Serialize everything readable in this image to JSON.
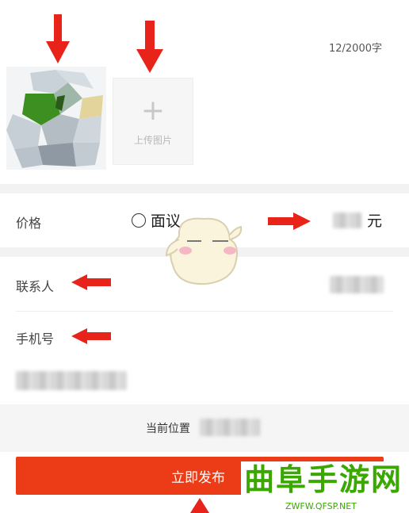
{
  "editor": {
    "char_count": "12/2000字"
  },
  "upload": {
    "plus": "+",
    "label": "上传图片"
  },
  "price": {
    "label": "价格",
    "negotiable_label": "面议",
    "unit": "元"
  },
  "contact": {
    "label": "联系人"
  },
  "phone": {
    "label": "手机号"
  },
  "location": {
    "label": "当前位置"
  },
  "publish": {
    "label": "立即发布"
  },
  "watermark": {
    "main": "曲阜手游网",
    "url": "ZWFW.QFSP.NET"
  },
  "colors": {
    "accent": "#ec3b17",
    "annotation_arrow": "#e8231a",
    "watermark": "#3aa800"
  }
}
